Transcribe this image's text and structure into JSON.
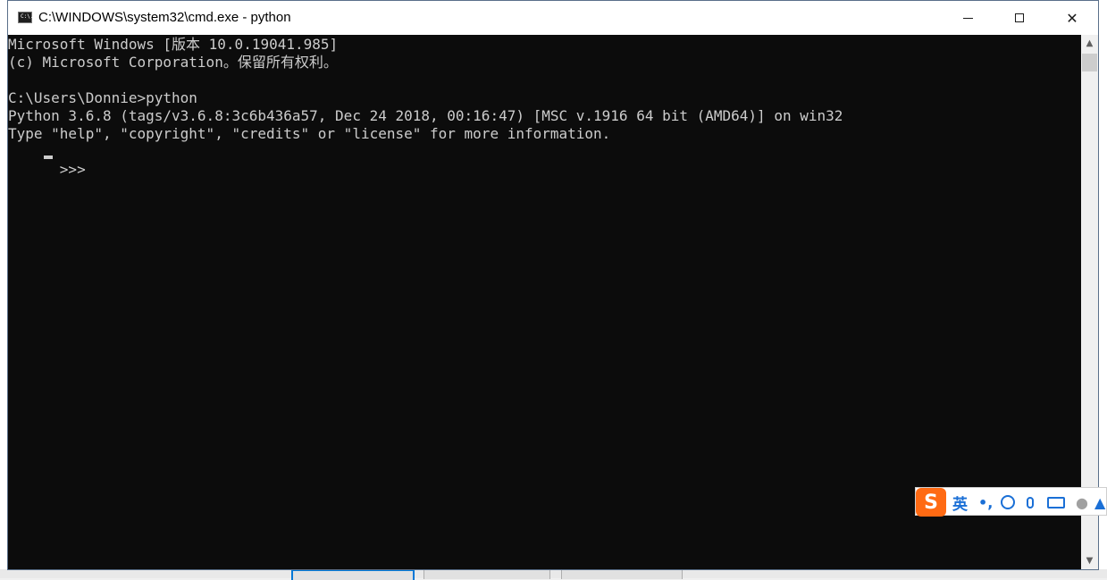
{
  "window": {
    "title": "C:\\WINDOWS\\system32\\cmd.exe - python",
    "icon": "cmd-icon",
    "icon_glyph": "C:\\.",
    "controls": {
      "minimize": "minimize-icon",
      "maximize": "maximize-icon",
      "close": "✕"
    }
  },
  "console": {
    "lines": [
      "Microsoft Windows [版本 10.0.19041.985]",
      "(c) Microsoft Corporation。保留所有权利。",
      "",
      "C:\\Users\\Donnie>python",
      "Python 3.6.8 (tags/v3.6.8:3c6b436a57, Dec 24 2018, 00:16:47) [MSC v.1916 64 bit (AMD64)] on win32",
      "Type \"help\", \"copyright\", \"credits\" or \"license\" for more information.",
      ">>> "
    ],
    "background": "#0c0c0c",
    "foreground": "#cccccc"
  },
  "scrollbar": {
    "up": "▲",
    "down": "▼"
  },
  "ime": {
    "logo": "S",
    "lang": "英",
    "punct": "•,",
    "icons": [
      "emoji-icon",
      "microphone-icon",
      "keyboard-icon",
      "user-icon",
      "arrow-up-icon"
    ],
    "accent": "#1a6fd6",
    "logo_color": "#ff6a13"
  }
}
